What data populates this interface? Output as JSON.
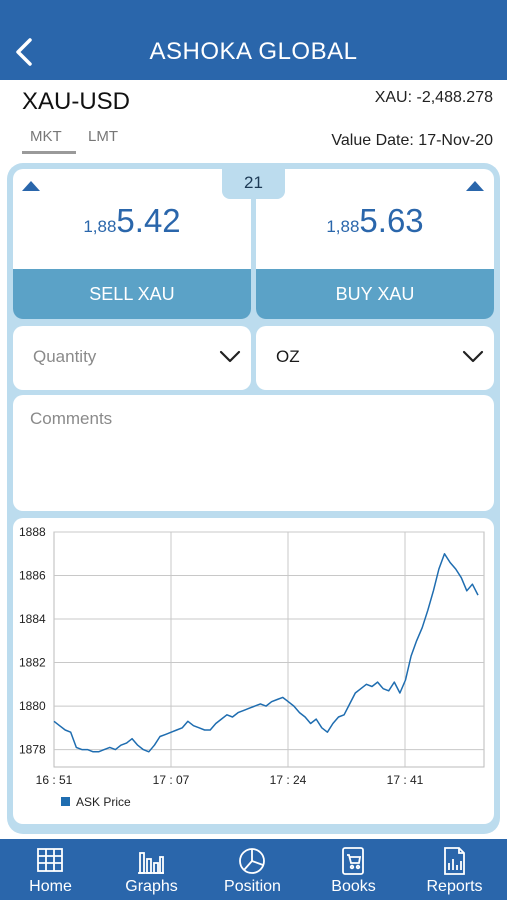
{
  "header": {
    "title": "ASHOKA GLOBAL"
  },
  "instrument": {
    "pair": "XAU-USD",
    "position": "XAU: -2,488.278",
    "value_date": "Value Date: 17-Nov-20"
  },
  "tabs": [
    {
      "label": "MKT",
      "active": true
    },
    {
      "label": "LMT",
      "active": false
    }
  ],
  "quote": {
    "spread": "21",
    "sell": {
      "prefix": "1,88",
      "main": "5.42",
      "button": "SELL XAU"
    },
    "buy": {
      "prefix": "1,88",
      "main": "5.63",
      "button": "BUY XAU"
    }
  },
  "order": {
    "quantity_placeholder": "Quantity",
    "unit": "OZ",
    "comments_placeholder": "Comments"
  },
  "chart_data": {
    "type": "line",
    "title": "",
    "xlabel": "",
    "ylabel": "",
    "x_ticks": [
      "16 : 51",
      "17 : 07",
      "17 : 24",
      "17 : 41"
    ],
    "y_ticks": [
      1878,
      1880,
      1882,
      1884,
      1886,
      1888
    ],
    "ylim": [
      1877.2,
      1888
    ],
    "grid": true,
    "legend": "bottom-left",
    "series": [
      {
        "name": "ASK Price",
        "color": "#1f6db0",
        "values": [
          1879.3,
          1879.1,
          1878.9,
          1878.8,
          1878.1,
          1878.0,
          1878.0,
          1877.9,
          1877.9,
          1878.0,
          1878.1,
          1878.0,
          1878.2,
          1878.3,
          1878.5,
          1878.2,
          1878.0,
          1877.9,
          1878.2,
          1878.6,
          1878.7,
          1878.8,
          1878.9,
          1879.0,
          1879.3,
          1879.1,
          1879.0,
          1878.9,
          1878.9,
          1879.2,
          1879.4,
          1879.6,
          1879.5,
          1879.7,
          1879.8,
          1879.9,
          1880.0,
          1880.1,
          1880.0,
          1880.2,
          1880.3,
          1880.4,
          1880.2,
          1880.0,
          1879.7,
          1879.5,
          1879.2,
          1879.4,
          1879.0,
          1878.8,
          1879.2,
          1879.5,
          1879.6,
          1880.1,
          1880.6,
          1880.8,
          1881.0,
          1880.9,
          1881.1,
          1880.8,
          1880.7,
          1881.1,
          1880.6,
          1881.2,
          1882.3,
          1883.0,
          1883.6,
          1884.4,
          1885.3,
          1886.3,
          1887.0,
          1886.6,
          1886.3,
          1885.9,
          1885.3,
          1885.6,
          1885.1
        ]
      }
    ]
  },
  "nav": [
    {
      "label": "Home",
      "icon": "home-grid-icon"
    },
    {
      "label": "Graphs",
      "icon": "bar-chart-icon"
    },
    {
      "label": "Position",
      "icon": "pie-chart-icon"
    },
    {
      "label": "Books",
      "icon": "cart-book-icon"
    },
    {
      "label": "Reports",
      "icon": "report-icon"
    }
  ]
}
